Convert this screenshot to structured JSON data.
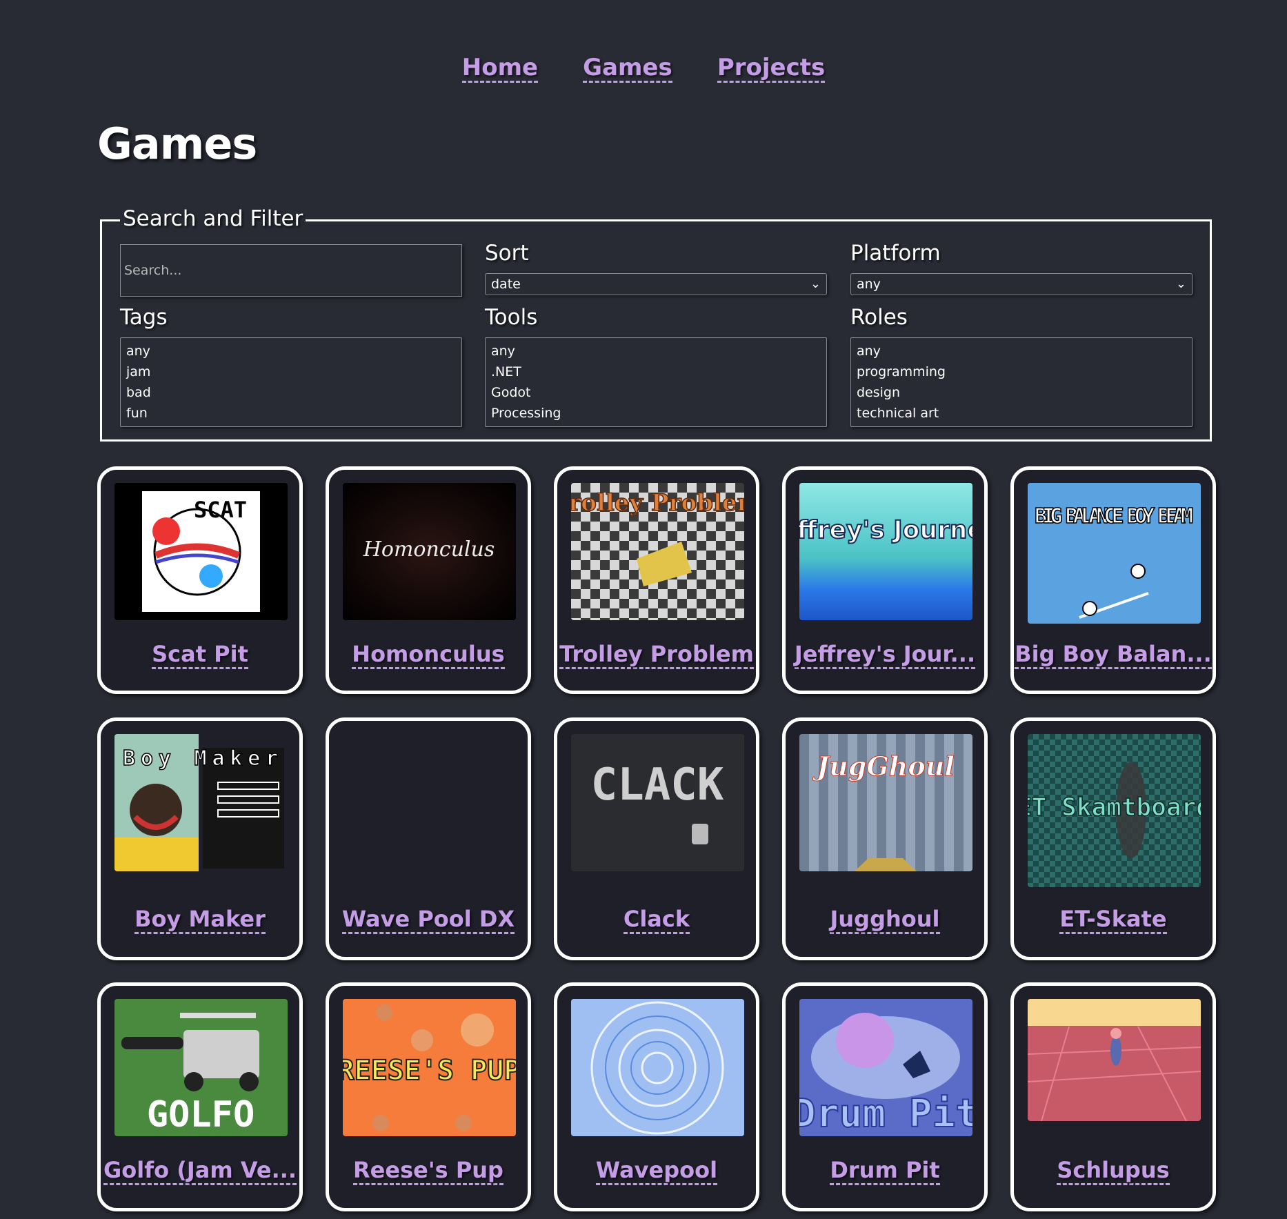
{
  "nav": {
    "home": "Home",
    "games": "Games",
    "projects": "Projects"
  },
  "page_title": "Games",
  "filter": {
    "legend": "Search and Filter",
    "search_placeholder": "Search...",
    "sort": {
      "label": "Sort",
      "value": "date"
    },
    "platform": {
      "label": "Platform",
      "value": "any"
    },
    "tags": {
      "label": "Tags",
      "options": [
        "any",
        "jam",
        "bad",
        "fun"
      ]
    },
    "tools": {
      "label": "Tools",
      "options": [
        "any",
        ".NET",
        "Godot",
        "Processing"
      ]
    },
    "roles": {
      "label": "Roles",
      "options": [
        "any",
        "programming",
        "design",
        "technical art"
      ]
    }
  },
  "games": [
    {
      "title": "Scat Pit",
      "thumb_text": "SCAT PIT"
    },
    {
      "title": "Homonculus",
      "thumb_text": "Homonculus"
    },
    {
      "title": "Trolley Problem",
      "thumb_text": "Trolley Problem"
    },
    {
      "title": "Jeffrey's Jour...",
      "thumb_text": "Jeffrey's Journey"
    },
    {
      "title": "Big Boy Balan...",
      "thumb_text": "BIG BALANCE BOY BEAM"
    },
    {
      "title": "Boy Maker",
      "thumb_text": "Boy Maker"
    },
    {
      "title": "Wave Pool DX",
      "thumb_text": ""
    },
    {
      "title": "Clack",
      "thumb_text": "CLACK"
    },
    {
      "title": "Jugghoul",
      "thumb_text": "JugGhoul"
    },
    {
      "title": "ET-Skate",
      "thumb_text": "ET Skamtboard"
    },
    {
      "title": "Golfo (Jam Ve...",
      "thumb_text": "GOLFO"
    },
    {
      "title": "Reese's Pup",
      "thumb_text": "REESE'S PUP"
    },
    {
      "title": "Wavepool",
      "thumb_text": ""
    },
    {
      "title": "Drum Pit",
      "thumb_text": "Drum Pit"
    },
    {
      "title": "Schlupus",
      "thumb_text": ""
    }
  ]
}
